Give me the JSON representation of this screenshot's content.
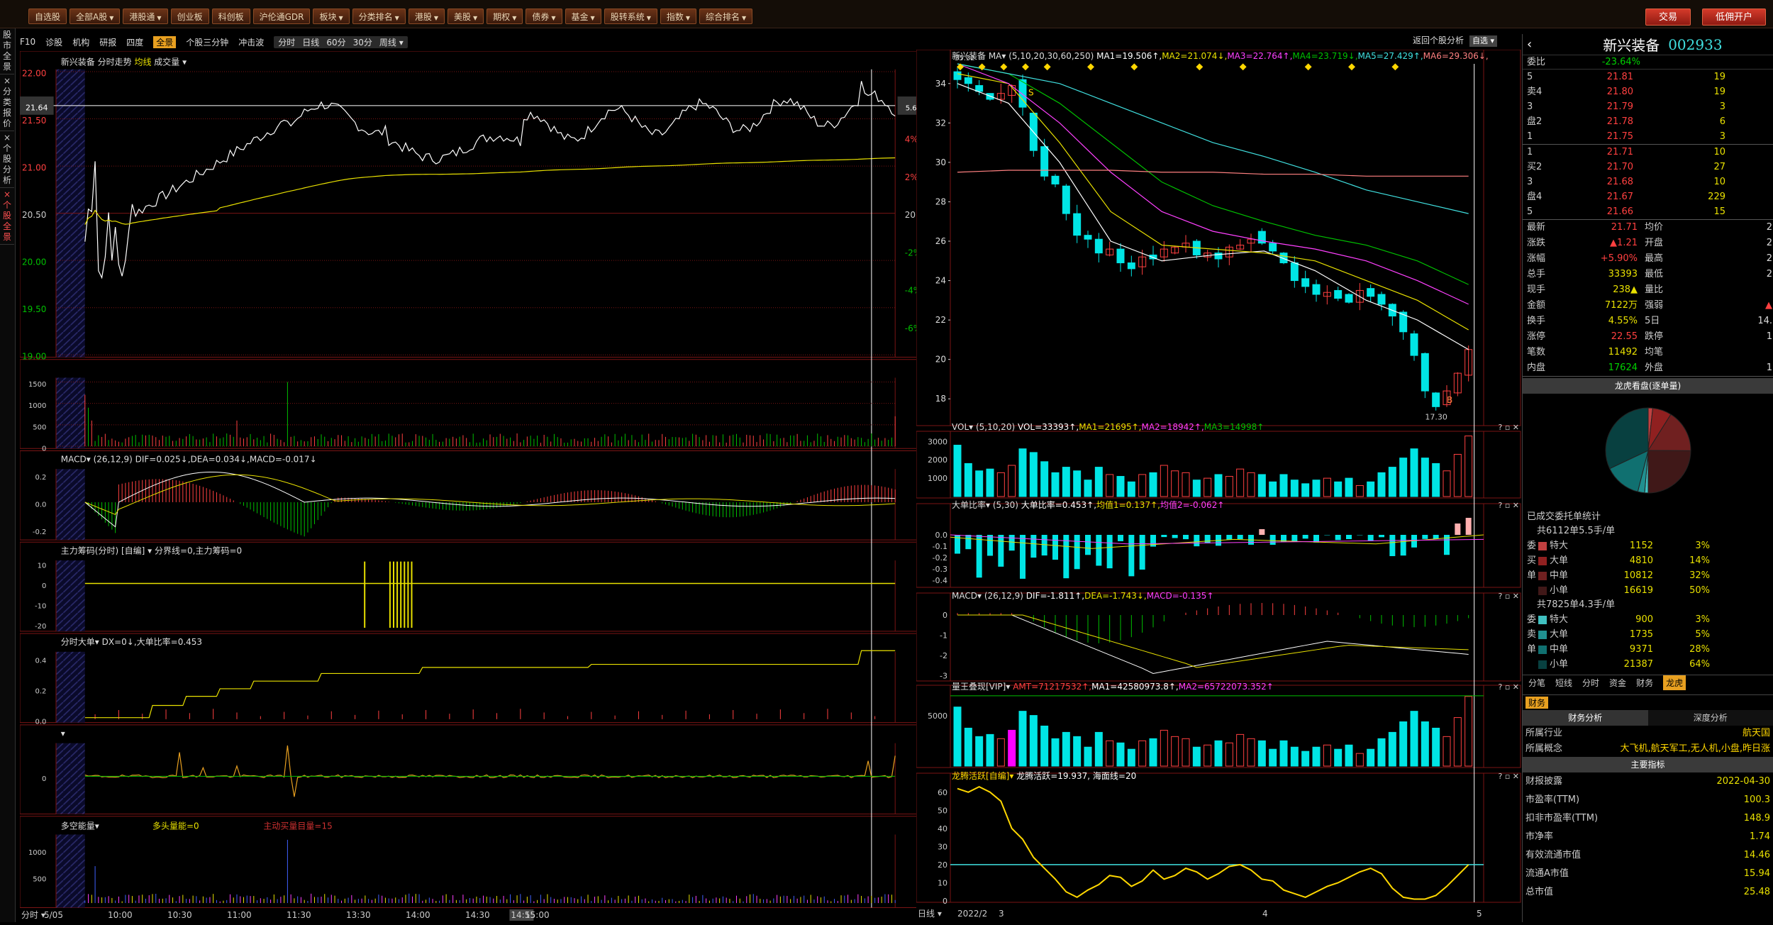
{
  "menu": [
    {
      "label": "自选股",
      "dd": false
    },
    {
      "label": "全部A股",
      "dd": true
    },
    {
      "label": "港股通",
      "dd": true
    },
    {
      "label": "创业板",
      "dd": false
    },
    {
      "label": "科创板",
      "dd": false
    },
    {
      "label": "沪伦通GDR",
      "dd": false
    },
    {
      "label": "板块",
      "dd": true
    },
    {
      "label": "分类排名",
      "dd": true
    },
    {
      "label": "港股",
      "dd": true
    },
    {
      "label": "美股",
      "dd": true
    },
    {
      "label": "期权",
      "dd": true
    },
    {
      "label": "债券",
      "dd": true
    },
    {
      "label": "基金",
      "dd": true
    },
    {
      "label": "股转系统",
      "dd": true
    },
    {
      "label": "指数",
      "dd": true
    },
    {
      "label": "综合排名",
      "dd": true
    }
  ],
  "trade": {
    "buy": "交易",
    "open": "低佣开户"
  },
  "subbar": {
    "items": [
      "F10",
      "诊股",
      "机构",
      "研报",
      "四度"
    ],
    "active": "全景",
    "items2": [
      "个股三分钟",
      "冲击波"
    ],
    "periods": [
      "分时",
      "日线",
      "60分",
      "30分",
      "周线"
    ]
  },
  "leftstrip": [
    "股市全景",
    "分类报价",
    "个股分析",
    "个股全景"
  ],
  "intraday": {
    "title": "新兴装备",
    "sub": "分时走势",
    "ma": "均线",
    "vol": "成交量",
    "yleft": [
      "22.00",
      "21.50",
      "21.00",
      "20.50",
      "20.00",
      "19.50",
      "19.00"
    ],
    "yright": [
      "6%",
      "4%",
      "2%",
      "20.50",
      "-2%",
      "-4%",
      "-6%"
    ],
    "cur_left": "21.64",
    "cur_right": "5.6%",
    "vol_ticks": [
      "1500",
      "1000",
      "500",
      "0"
    ],
    "macd": {
      "name": "MACD",
      "params": "(26,12,9)",
      "dif": "DIF=0.025",
      "dea": "DEA=0.034",
      "macd": "MACD=-0.017",
      "ticks": [
        "0.2",
        "0.0",
        "-0.2"
      ]
    },
    "zljm": {
      "name": "主力筹码(分时)",
      "mode": "[自编]",
      "desc": "分界线=0,主力筹码=0",
      "ticks": [
        "10",
        "0",
        "-10",
        "-20"
      ]
    },
    "fsdd": {
      "name": "分时大单",
      "dx": "DX=0",
      "ratio": "大单比率=0.453",
      "ticks": [
        "0.4",
        "0.2",
        "0.0"
      ]
    },
    "p5": {
      "ticks": [
        "0"
      ]
    },
    "dkn": {
      "name": "多空能量",
      "val": "多头量能=0",
      "extra": "主动买量目量=15",
      "ticks": [
        "1000",
        "500"
      ]
    },
    "xaxis": [
      "5/05",
      "10:00",
      "10:30",
      "11:00",
      "11:30",
      "13:30",
      "14:00",
      "14:30",
      "14:55",
      "15:00"
    ],
    "xlabel": "分时"
  },
  "daily": {
    "title": "新兴装备",
    "ma": "MA",
    "params": "(5,10,20,30,60,250)",
    "mas": [
      "MA1=19.506",
      "MA2=21.074",
      "MA3=22.764",
      "MA4=23.719",
      "MA5=27.429",
      "MA6=29.306"
    ],
    "back": "返回个股分析",
    "mode": "平移",
    "pick": "自选",
    "yticks": [
      "34",
      "32",
      "30",
      "28",
      "26",
      "24",
      "22",
      "20",
      "18"
    ],
    "hi": "35.32",
    "lo": "17.30",
    "vol": {
      "name": "VOL",
      "params": "(5,10,20)",
      "vals": "VOL=33393",
      "ma1": "MA1=21695",
      "ma2": "MA2=18942",
      "ma3": "MA3=14998",
      "ticks": [
        "3000",
        "2000",
        "1000"
      ]
    },
    "ddbl": {
      "name": "大单比率",
      "params": "(5,30)",
      "val": "大单比率=0.453",
      "a": "均值1=0.137",
      "b": "均值2=-0.062",
      "ticks": [
        "0.0",
        "-0.1",
        "-0.2",
        "-0.3",
        "-0.4"
      ]
    },
    "macd": {
      "name": "MACD",
      "params": "(26,12,9)",
      "dif": "DIF=-1.811",
      "dea": "DEA=-1.743",
      "macd": "MACD=-0.135",
      "ticks": [
        "0",
        "-1",
        "-2",
        "-3"
      ]
    },
    "lw": {
      "name": "量王叠现[VIP]",
      "amt": "AMT=71217532",
      "ma1": "MA1=42580973.8",
      "ma2": "MA2=65722073.352",
      "ticks": [
        "5000"
      ]
    },
    "lt": {
      "name": "龙腾活跃[自编]",
      "val": "龙腾活跃=19.937",
      "line": "海面线=20",
      "ticks": [
        "60",
        "50",
        "40",
        "30",
        "20",
        "10",
        "0"
      ]
    },
    "xaxis": [
      "2022/2",
      "3",
      "4",
      "5"
    ],
    "xlabel": "日线"
  },
  "quote": {
    "name": "新兴装备",
    "code": "002933",
    "wb_label": "委比",
    "wb": "-23.64%",
    "asks": [
      {
        "l": "5",
        "p": "21.81",
        "v": "19"
      },
      {
        "l": "卖4",
        "p": "21.80",
        "v": "19"
      },
      {
        "l": "3",
        "p": "21.79",
        "v": "3"
      },
      {
        "l": "盘2",
        "p": "21.78",
        "v": "6"
      },
      {
        "l": "1",
        "p": "21.75",
        "v": "3"
      }
    ],
    "bids": [
      {
        "l": "1",
        "p": "21.71",
        "v": "10"
      },
      {
        "l": "买2",
        "p": "21.70",
        "v": "27"
      },
      {
        "l": "3",
        "p": "21.68",
        "v": "10"
      },
      {
        "l": "盘4",
        "p": "21.67",
        "v": "229"
      },
      {
        "l": "5",
        "p": "21.66",
        "v": "15"
      }
    ],
    "stats": [
      [
        "最新",
        "21.71",
        "均价",
        "2"
      ],
      [
        "涨跌",
        "▲1.21",
        "开盘",
        "2"
      ],
      [
        "涨幅",
        "+5.90%",
        "最高",
        "2"
      ],
      [
        "总手",
        "33393",
        "最低",
        "2"
      ],
      [
        "现手",
        "238▲",
        "量比",
        ""
      ],
      [
        "金额",
        "7122万",
        "强弱",
        "▲"
      ],
      [
        "换手",
        "4.55%",
        "5日",
        "14."
      ],
      [
        "涨停",
        "22.55",
        "跌停",
        "1"
      ],
      [
        "笔数",
        "11492",
        "均笔",
        ""
      ],
      [
        "内盘",
        "17624",
        "外盘",
        "1"
      ]
    ],
    "pie_title": "龙虎看盘(逐单量)",
    "orders_title": "已成交委托单统计",
    "buy_head": "共6112单5.5手/单",
    "buy": [
      {
        "s": "委",
        "n": "特大",
        "v": "1152",
        "p": "3%"
      },
      {
        "s": "买",
        "n": "大单",
        "v": "4810",
        "p": "14%"
      },
      {
        "s": "单",
        "n": "中单",
        "v": "10812",
        "p": "32%"
      },
      {
        "s": "",
        "n": "小单",
        "v": "16619",
        "p": "50%"
      }
    ],
    "sell_head": "共7825单4.3手/单",
    "sell": [
      {
        "s": "委",
        "n": "特大",
        "v": "900",
        "p": "3%"
      },
      {
        "s": "卖",
        "n": "大单",
        "v": "1735",
        "p": "5%"
      },
      {
        "s": "单",
        "n": "中单",
        "v": "9371",
        "p": "28%"
      },
      {
        "s": "",
        "n": "小单",
        "v": "21387",
        "p": "64%"
      }
    ],
    "tabs": [
      "分笔",
      "短线",
      "分时",
      "资金",
      "财务"
    ],
    "tab_on": "龙虎",
    "fin_tab": "财务",
    "fin_sub1": "财务分析",
    "fin_sub2": "深度分析",
    "industry_l": "所属行业",
    "industry": "航天国",
    "concept_l": "所属概念",
    "concept": "大飞机,航天军工,无人机,小盘,昨日涨",
    "key_title": "主要指标",
    "fin": [
      [
        "财报披露",
        "2022-04-30"
      ],
      [
        "市盈率(TTM)",
        "100.3"
      ],
      [
        "扣非市盈率(TTM)",
        "148.9"
      ],
      [
        "市净率",
        "1.74"
      ],
      [
        "有效流通市值",
        "14.46"
      ],
      [
        "流通A市值",
        "15.94"
      ],
      [
        "总市值",
        "25.48"
      ]
    ]
  },
  "colors": {
    "up": "#ff4040",
    "down": "#00e5e5",
    "price": "#ffffff",
    "avg": "#e8e000",
    "grid": "#7a1414"
  }
}
